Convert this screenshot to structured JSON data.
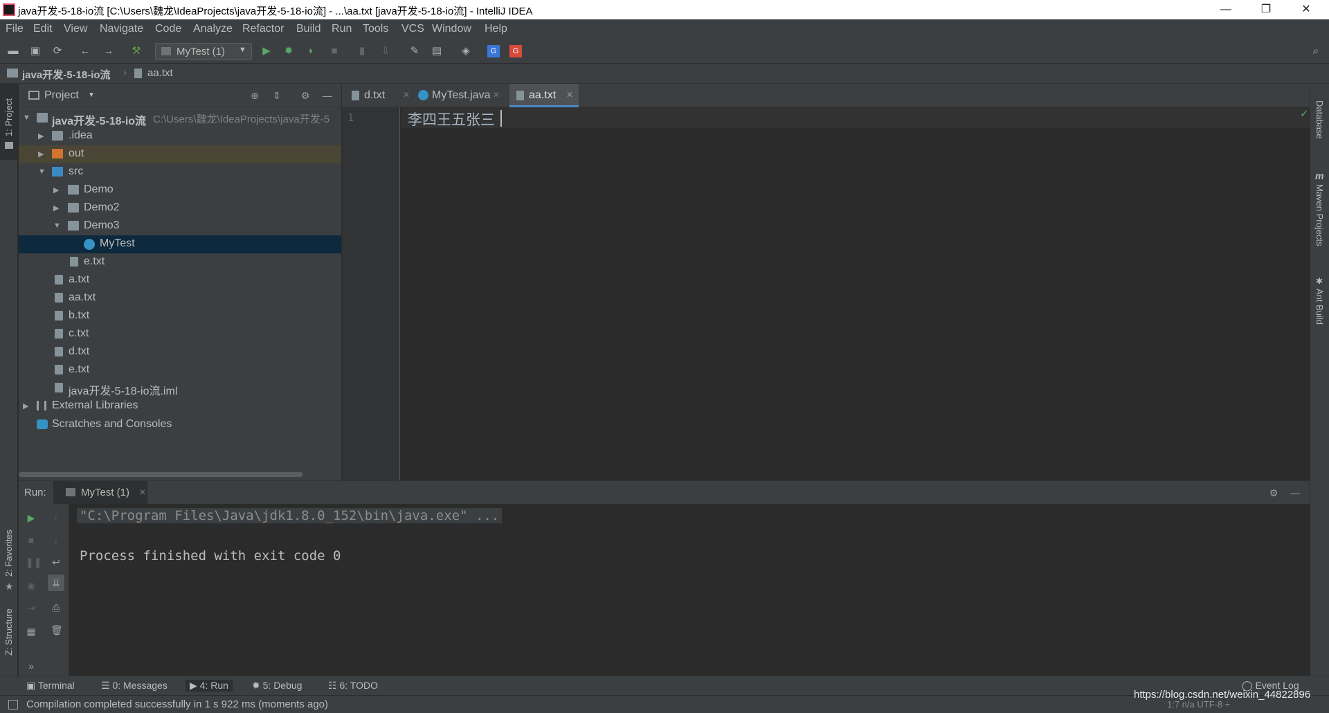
{
  "window": {
    "title": "java开发-5-18-io流 [C:\\Users\\魏龙\\IdeaProjects\\java开发-5-18-io流] - ...\\aa.txt [java开发-5-18-io流] - IntelliJ IDEA",
    "minimize": "—",
    "restore": "❐",
    "close": "✕"
  },
  "menu": [
    "File",
    "Edit",
    "View",
    "Navigate",
    "Code",
    "Analyze",
    "Refactor",
    "Build",
    "Run",
    "Tools",
    "VCS",
    "Window",
    "Help"
  ],
  "toolbar": {
    "run_config": "MyTest (1)"
  },
  "breadcrumb": {
    "project": "java开发-5-18-io流",
    "file": "aa.txt"
  },
  "left_strip": {
    "project": "1: Project",
    "favorites": "2: Favorites",
    "structure": "Z: Structure"
  },
  "right_strip": {
    "database": "Database",
    "maven": "Maven Projects",
    "ant": "Ant Build"
  },
  "project_panel": {
    "title": "Project",
    "root_name": "java开发-5-18-io流",
    "root_path": "C:\\Users\\魏龙\\IdeaProjects\\java开发-5",
    "items": {
      "idea": ".idea",
      "out": "out",
      "src": "src",
      "demo": "Demo",
      "demo2": "Demo2",
      "demo3": "Demo3",
      "mytest": "MyTest",
      "e_inner": "e.txt",
      "a": "a.txt",
      "aa": "aa.txt",
      "b": "b.txt",
      "c": "c.txt",
      "d": "d.txt",
      "e": "e.txt",
      "iml": "java开发-5-18-io流.iml",
      "extlib": "External Libraries",
      "scratches": "Scratches and Consoles"
    }
  },
  "editor": {
    "tabs": [
      "d.txt",
      "MyTest.java",
      "aa.txt"
    ],
    "line_number": "1",
    "content": "李四王五张三"
  },
  "run_panel": {
    "label": "Run:",
    "tab": "MyTest (1)",
    "cmd": "\"C:\\Program Files\\Java\\jdk1.8.0_152\\bin\\java.exe\" ...",
    "finished": "Process finished with exit code 0"
  },
  "bottom_tabs": {
    "terminal": "Terminal",
    "messages": "0: Messages",
    "run": "4: Run",
    "debug": "5: Debug",
    "todo": "6: TODO",
    "event_log": "Event Log"
  },
  "status": {
    "message": "Compilation completed successfully in 1 s 922 ms (moments ago)",
    "right": "1:7   n/a   UTF-8 ÷",
    "watermark": "https://blog.csdn.net/weixin_44822896"
  }
}
